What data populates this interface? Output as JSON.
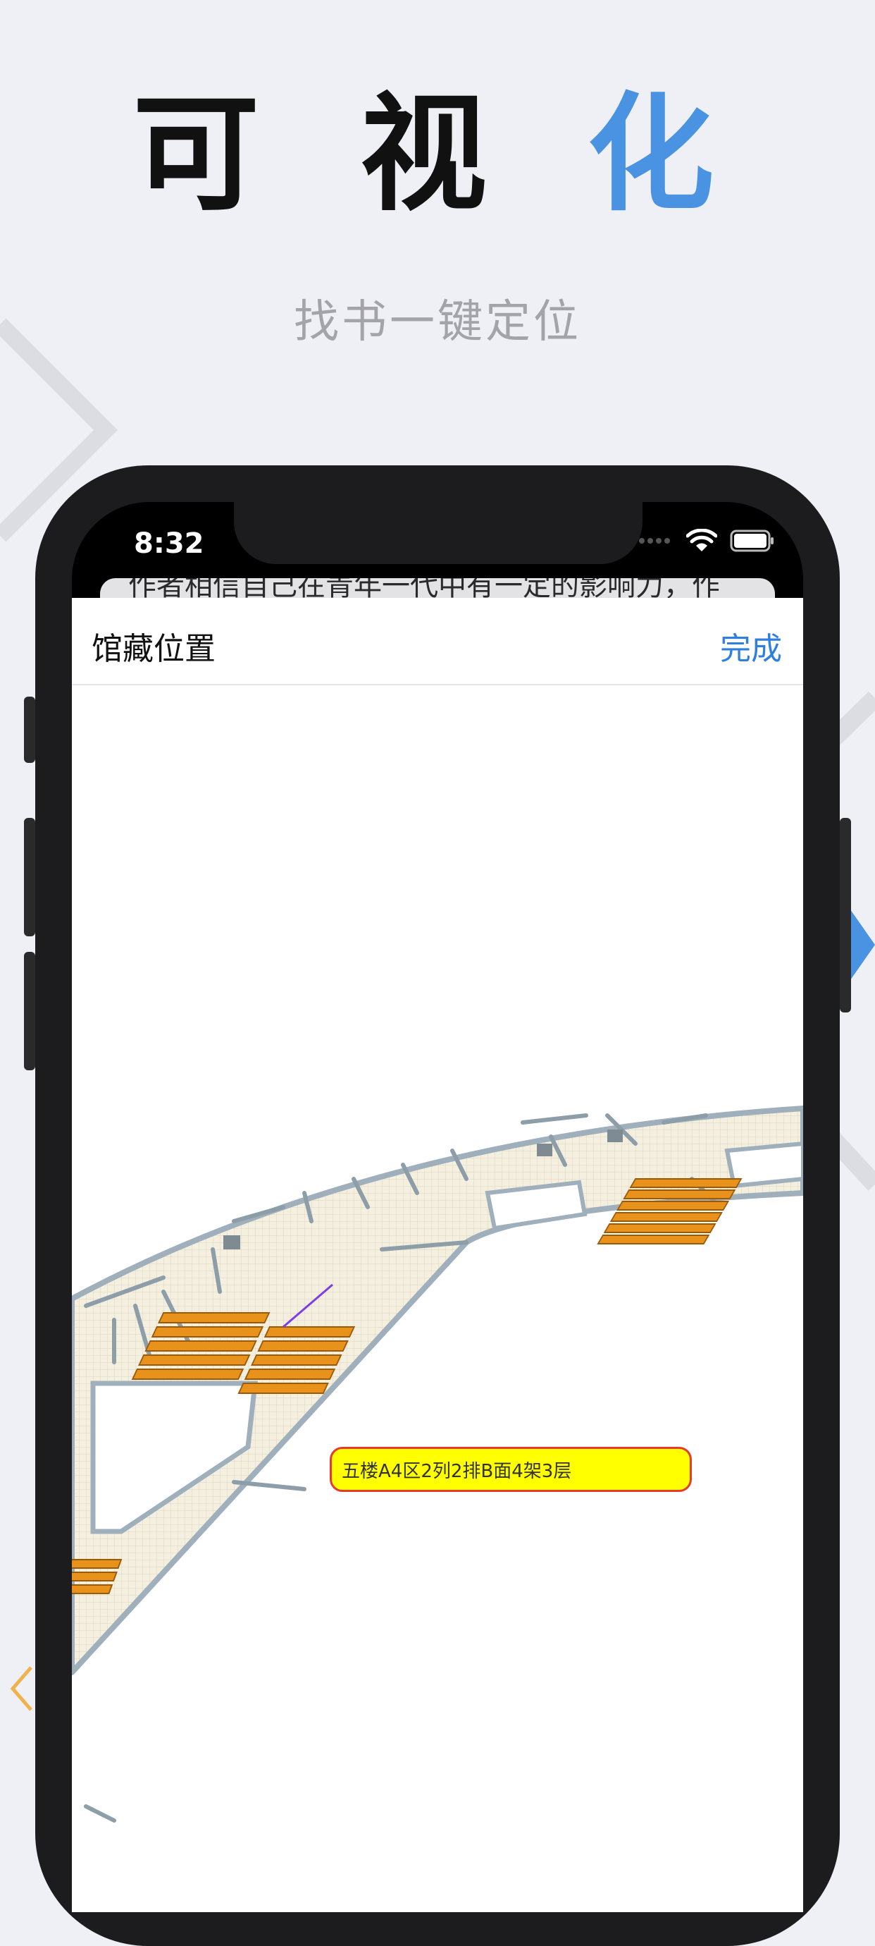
{
  "headline": {
    "part1": "可 视 ",
    "accent": "化"
  },
  "subline": "找书一键定位",
  "status_bar": {
    "time": "8:32"
  },
  "behind_text": "作者相信自己在青年一代中有一定的影响力，作",
  "nav": {
    "title": "馆藏位置",
    "done_label": "完成"
  },
  "map": {
    "location_label": "五楼A4区2列2排B面4架3层"
  },
  "colors": {
    "accent": "#4a93e3",
    "link": "#2f7fe0",
    "shelf": "#e8921c",
    "floor": "#f4efdf",
    "tag_fill": "#ffff00",
    "tag_border": "#e63a2e"
  },
  "icons": [
    "wifi-icon",
    "battery-icon",
    "location-pointer-icon"
  ]
}
